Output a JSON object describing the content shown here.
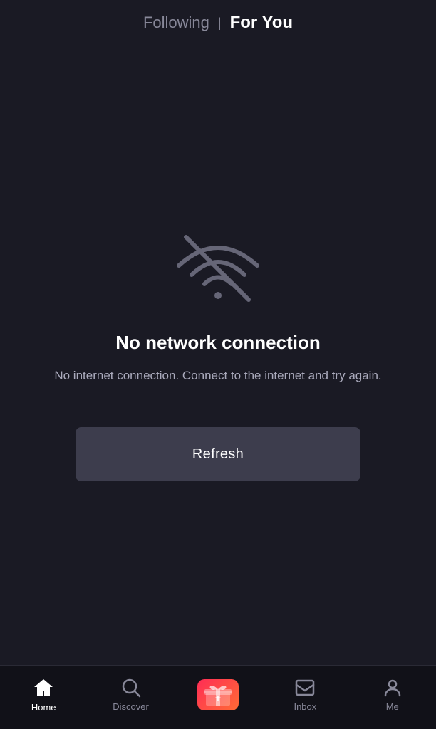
{
  "header": {
    "following_label": "Following",
    "divider": "|",
    "foryou_label": "For You"
  },
  "error": {
    "title": "No network connection",
    "subtitle": "No internet connection. Connect to the internet and try again."
  },
  "refresh_button": {
    "label": "Refresh"
  },
  "bottom_nav": {
    "items": [
      {
        "id": "home",
        "label": "Home",
        "active": true
      },
      {
        "id": "discover",
        "label": "Discover",
        "active": false
      },
      {
        "id": "add",
        "label": "",
        "active": false
      },
      {
        "id": "inbox",
        "label": "Inbox",
        "active": false
      },
      {
        "id": "me",
        "label": "Me",
        "active": false
      }
    ]
  }
}
